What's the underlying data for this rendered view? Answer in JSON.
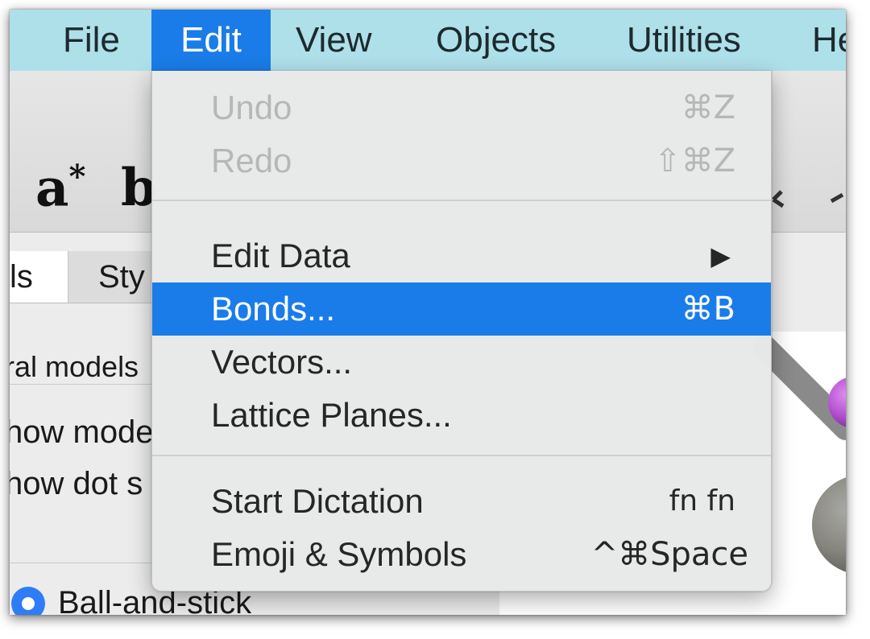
{
  "menubar": {
    "items": [
      {
        "label": "File"
      },
      {
        "label": "Edit"
      },
      {
        "label": "View"
      },
      {
        "label": "Objects"
      },
      {
        "label": "Utilities"
      },
      {
        "label": "He"
      }
    ]
  },
  "toolbar": {
    "a_star_main": "a",
    "a_star_sup": "*",
    "b_partial": "b"
  },
  "left_panel": {
    "tabs": [
      {
        "label": "ls"
      },
      {
        "label": "Sty"
      }
    ],
    "section_label": "ral models",
    "rows": [
      {
        "label": "how mode"
      },
      {
        "label": "how dot s"
      }
    ],
    "radio_option": "Ball-and-stick"
  },
  "edit_menu": {
    "items": [
      {
        "label": "Undo",
        "shortcut": "⌘Z",
        "enabled": false
      },
      {
        "label": "Redo",
        "shortcut": "⇧⌘Z",
        "enabled": false
      },
      {
        "label": "Edit Data",
        "shortcut": "▶",
        "enabled": true
      },
      {
        "label": "Bonds...",
        "shortcut": "⌘B",
        "enabled": true,
        "highlighted": true
      },
      {
        "label": "Vectors...",
        "shortcut": "",
        "enabled": true
      },
      {
        "label": "Lattice Planes...",
        "shortcut": "",
        "enabled": true
      },
      {
        "label": "Start Dictation",
        "shortcut": "fn fn",
        "enabled": true
      },
      {
        "label": "Emoji & Symbols",
        "shortcut": "^⌘Space",
        "enabled": true
      }
    ]
  },
  "colors": {
    "menubar_bg": "#aee0ea",
    "accent": "#1a7ce8",
    "atom_magenta": "#b24fd0",
    "atom_gray": "#86867f",
    "bond_gray": "#8a8a8a"
  }
}
